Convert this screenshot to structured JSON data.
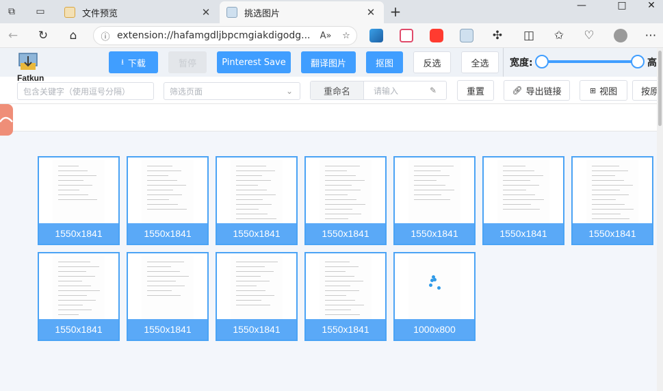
{
  "browser": {
    "tabs": [
      {
        "title": "文件预览",
        "active": false
      },
      {
        "title": "挑选图片",
        "active": true
      }
    ],
    "new_tab_symbol": "+",
    "url": "extension://hafamgdljbpcmgiakdigodg...",
    "window_controls": [
      "—",
      "□",
      "✕"
    ]
  },
  "app": {
    "logo_text": "Fatkun",
    "buttons": {
      "download": "下载",
      "pause": "暂停",
      "pinterest": "Pinterest Save",
      "translate": "翻译图片",
      "cutout": "抠图",
      "invert": "反选",
      "select_all": "全选"
    },
    "width_label": "宽度:",
    "height_label": "高",
    "keyword_placeholder": "包含关键字（使用逗号分隔）",
    "filter_page_placeholder": "筛选页面",
    "rename_label": "重命名",
    "rename_placeholder": "请输入",
    "reset": "重置",
    "export_links": "导出链接",
    "view": "视图",
    "sort": "按原"
  },
  "images": [
    {
      "size": "1550x1841"
    },
    {
      "size": "1550x1841"
    },
    {
      "size": "1550x1841"
    },
    {
      "size": "1550x1841"
    },
    {
      "size": "1550x1841"
    },
    {
      "size": "1550x1841"
    },
    {
      "size": "1550x1841"
    },
    {
      "size": "1550x1841"
    },
    {
      "size": "1550x1841"
    },
    {
      "size": "1550x1841"
    },
    {
      "size": "1550x1841"
    },
    {
      "size": "1000x800"
    }
  ],
  "colors": {
    "accent": "#409eff",
    "caption_bg": "#5aa9f7",
    "card_border": "#4aa3f5",
    "side_tab": "#ef8e78"
  }
}
